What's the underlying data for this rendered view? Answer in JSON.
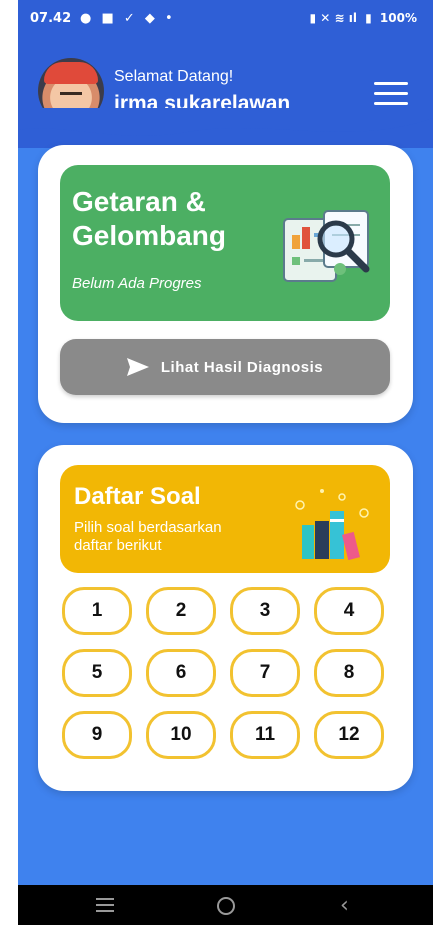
{
  "status_bar": {
    "time": "07.42",
    "battery": "100%"
  },
  "header": {
    "greeting": "Selamat Datang!",
    "username": "irma sukarelawan"
  },
  "topic_card": {
    "title": "Getaran & Gelombang",
    "progress": "Belum Ada Progres",
    "diagnosis_button": "Lihat Hasil Diagnosis"
  },
  "soal_card": {
    "title": "Daftar Soal",
    "subtitle": "Pilih soal berdasarkan daftar berikut",
    "questions": [
      "1",
      "2",
      "3",
      "4",
      "5",
      "6",
      "7",
      "8",
      "9",
      "10",
      "11",
      "12"
    ]
  },
  "colors": {
    "primary_blue": "#3f82ee",
    "header_blue": "#2f5fd6",
    "topic_green": "#4caf63",
    "soal_yellow": "#f2b705",
    "button_gray": "#8a8a8a"
  }
}
